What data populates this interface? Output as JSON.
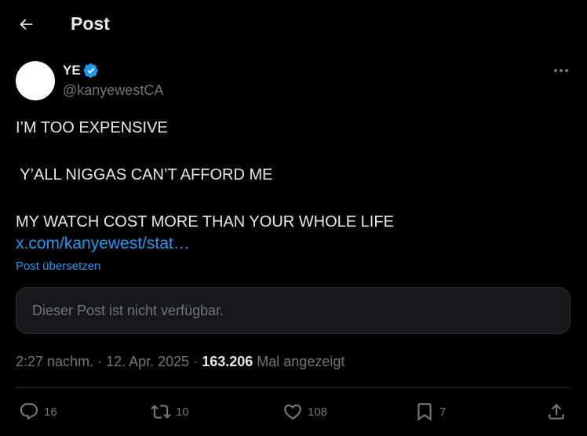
{
  "header": {
    "title": "Post"
  },
  "author": {
    "display_name": "YE",
    "handle": "@kanyewestCA"
  },
  "post": {
    "lines": [
      "I’M TOO EXPENSIVE",
      "",
      " Y’ALL NIGGAS CAN’T AFFORD ME",
      "",
      "MY WATCH COST MORE THAN YOUR WHOLE LIFE"
    ],
    "link": "x.com/kanyewest/stat…",
    "translate_label": "Post übersetzen"
  },
  "quote": {
    "text": "Dieser Post ist nicht verfügbar."
  },
  "meta": {
    "time": "2:27 nachm.",
    "date": "12. Apr. 2025",
    "views": "163.206",
    "views_label": "Mal angezeigt"
  },
  "actions": {
    "replies": "16",
    "reposts": "10",
    "likes": "108",
    "bookmarks": "7"
  },
  "colors": {
    "accent": "#1d9bf0",
    "background": "#000000",
    "secondary_text": "#71767b"
  }
}
